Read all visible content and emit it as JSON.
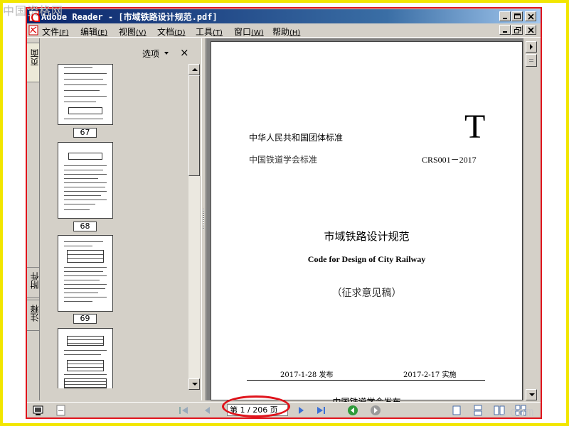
{
  "watermark": {
    "top_left": "中国资格网",
    "bottom_right": ".com"
  },
  "window": {
    "title": "Adobe Reader - [市域铁路设计规范.pdf]"
  },
  "menu": [
    {
      "label": "文件",
      "key": "(F)"
    },
    {
      "label": "编辑",
      "key": "(E)"
    },
    {
      "label": "视图",
      "key": "(V)"
    },
    {
      "label": "文档",
      "key": "(D)"
    },
    {
      "label": "工具",
      "key": "(T)"
    },
    {
      "label": "窗口",
      "key": "(W)"
    },
    {
      "label": "帮助",
      "key": "(H)"
    }
  ],
  "side_tabs": {
    "pages": "页面",
    "attachments": "附件",
    "comments": "注释"
  },
  "thumbnails_panel": {
    "options_label": "选项",
    "close_glyph": "×",
    "pages": [
      "67",
      "68",
      "69"
    ]
  },
  "document": {
    "big_letter": "T",
    "standard_line1": "中华人民共和国团体标准",
    "standard_line2": "中国铁道学会标准",
    "code": "CRS001－2017",
    "title_cn": "市域铁路设计规范",
    "title_en": "Code for Design of City Railway",
    "draft_note": "（征求意见稿）",
    "publish_date": "2017-1-28 发布",
    "implement_date": "2017-2-17 实施",
    "issuer": "中国铁道学会发布"
  },
  "navigation": {
    "page_indicator": "第 1 / 206 页"
  },
  "icons": [
    "adobe-icon",
    "minimize-icon",
    "maximize-icon",
    "close-icon",
    "first-page-icon",
    "prev-page-icon",
    "next-page-icon",
    "last-page-icon",
    "go-back-icon",
    "go-forward-icon",
    "single-page-icon",
    "continuous-icon",
    "facing-icon",
    "continuous-facing-icon"
  ],
  "colors": {
    "highlight_red": "#e0141c",
    "border_yellow": "#f2e600",
    "titlebar_blue": "#0a246a",
    "chrome_gray": "#d4d0c8",
    "doc_background": "#808080"
  }
}
